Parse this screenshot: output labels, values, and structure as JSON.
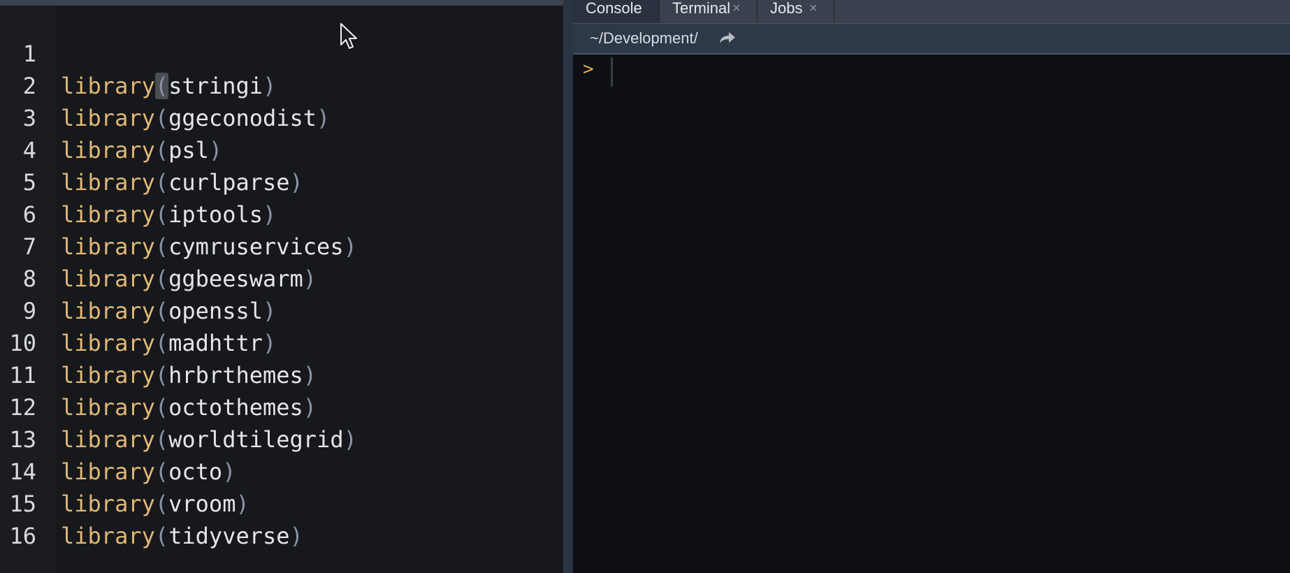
{
  "editor": {
    "lines": [
      {
        "number": "1",
        "fn": "library",
        "open": "(",
        "arg": "stringi",
        "close": ")"
      },
      {
        "number": "2",
        "fn": "library",
        "open": "(",
        "arg": "ggeconodist",
        "close": ")"
      },
      {
        "number": "3",
        "fn": "library",
        "open": "(",
        "arg": "psl",
        "close": ")"
      },
      {
        "number": "4",
        "fn": "library",
        "open": "(",
        "arg": "curlparse",
        "close": ")"
      },
      {
        "number": "5",
        "fn": "library",
        "open": "(",
        "arg": "iptools",
        "close": ")"
      },
      {
        "number": "6",
        "fn": "library",
        "open": "(",
        "arg": "cymruservices",
        "close": ")"
      },
      {
        "number": "7",
        "fn": "library",
        "open": "(",
        "arg": "ggbeeswarm",
        "close": ")"
      },
      {
        "number": "8",
        "fn": "library",
        "open": "(",
        "arg": "openssl",
        "close": ")"
      },
      {
        "number": "9",
        "fn": "library",
        "open": "(",
        "arg": "madhttr",
        "close": ")"
      },
      {
        "number": "10",
        "fn": "library",
        "open": "(",
        "arg": "hrbrthemes",
        "close": ")"
      },
      {
        "number": "11",
        "fn": "library",
        "open": "(",
        "arg": "octothemes",
        "close": ")"
      },
      {
        "number": "12",
        "fn": "library",
        "open": "(",
        "arg": "worldtilegrid",
        "close": ")"
      },
      {
        "number": "13",
        "fn": "library",
        "open": "(",
        "arg": "octo",
        "close": ")"
      },
      {
        "number": "14",
        "fn": "library",
        "open": "(",
        "arg": "vroom",
        "close": ")"
      },
      {
        "number": "15",
        "fn": "library",
        "open": "(",
        "arg": "tidyverse",
        "close": ")"
      },
      {
        "number": "16",
        "fn": "",
        "open": "",
        "arg": "",
        "close": ""
      }
    ]
  },
  "console": {
    "tabs": [
      {
        "label": "Console",
        "close": ""
      },
      {
        "label": "Terminal",
        "close": "×"
      },
      {
        "label": "Jobs",
        "close": "×"
      }
    ],
    "path": "~/Development/",
    "prompt": ">",
    "input_value": ""
  },
  "icons": {
    "mouse_pointer": "mouse-pointer-icon",
    "path_arrow": "go-to-directory-icon"
  },
  "colors": {
    "function": "#e0b878",
    "paren": "#8b94a6",
    "argument": "#e4e6ea",
    "prompt": "#e0a94a"
  }
}
